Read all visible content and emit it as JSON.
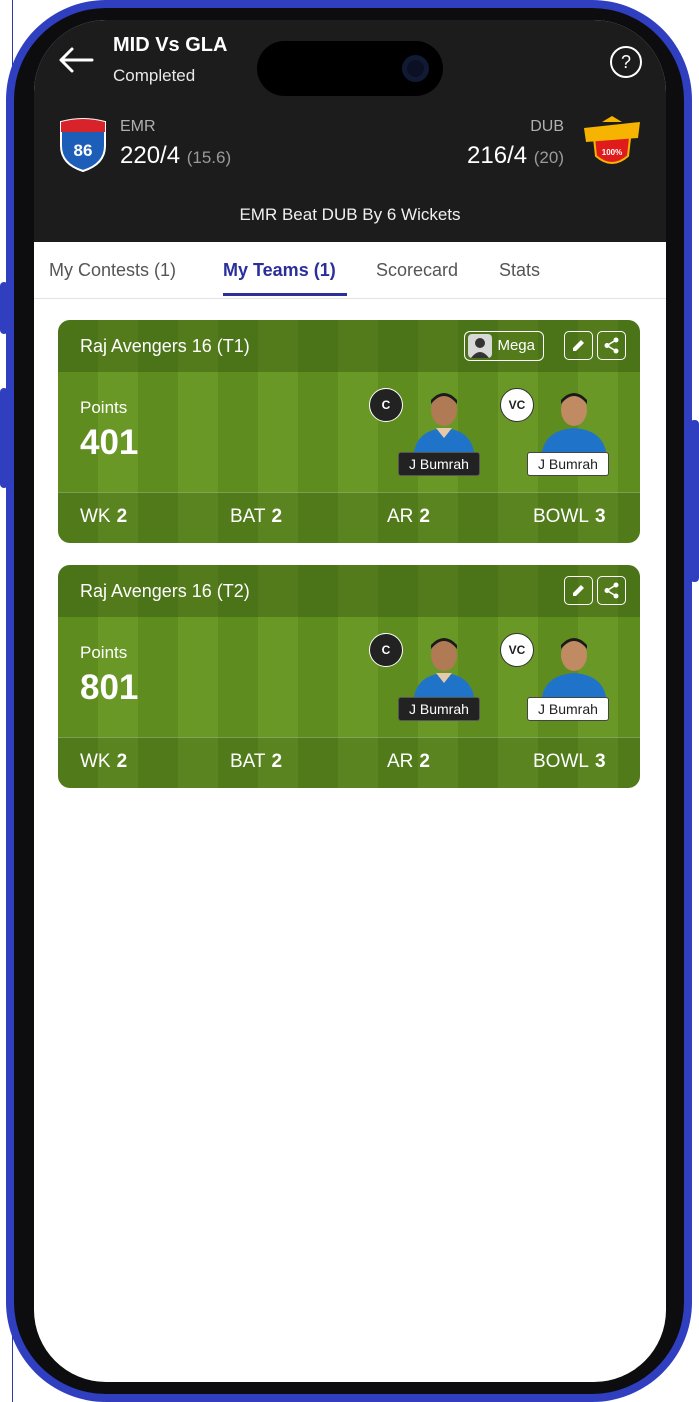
{
  "header": {
    "match_title": "MID Vs GLA",
    "match_status": "Completed",
    "help_glyph": "?",
    "team_left": {
      "name": "EMR",
      "score": "220/4",
      "overs": "(15.6)",
      "logo_text": "86"
    },
    "team_right": {
      "name": "DUB",
      "score": "216/4",
      "overs": "(20)",
      "logo_text": "100%"
    },
    "result": "EMR Beat DUB By 6 Wickets"
  },
  "tabs": [
    {
      "label": "My Contests (1)",
      "active": false
    },
    {
      "label": "My Teams (1)",
      "active": true
    },
    {
      "label": "Scorecard",
      "active": false
    },
    {
      "label": "Stats",
      "active": false
    }
  ],
  "teams": [
    {
      "title": "Raj Avengers 16 (T1)",
      "tag": "Mega",
      "points_label": "Points",
      "points": "401",
      "captain": {
        "badge": "C",
        "name": "J Bumrah"
      },
      "vice_captain": {
        "badge": "VC",
        "name": "J Bumrah"
      },
      "stats": [
        {
          "label": "WK",
          "value": "2"
        },
        {
          "label": "BAT",
          "value": "2"
        },
        {
          "label": "AR",
          "value": "2"
        },
        {
          "label": "BOWL",
          "value": "3"
        }
      ]
    },
    {
      "title": "Raj Avengers 16 (T2)",
      "points_label": "Points",
      "points": "801",
      "captain": {
        "badge": "C",
        "name": "J Bumrah"
      },
      "vice_captain": {
        "badge": "VC",
        "name": "J Bumrah"
      },
      "stats": [
        {
          "label": "WK",
          "value": "2"
        },
        {
          "label": "BAT",
          "value": "2"
        },
        {
          "label": "AR",
          "value": "2"
        },
        {
          "label": "BOWL",
          "value": "3"
        }
      ]
    }
  ],
  "colors": {
    "header_bg": "#1c1c1c",
    "accent": "#2a2f9c",
    "pitch_green": "#5f8c1f",
    "frame_blue": "#2f3fbf"
  }
}
